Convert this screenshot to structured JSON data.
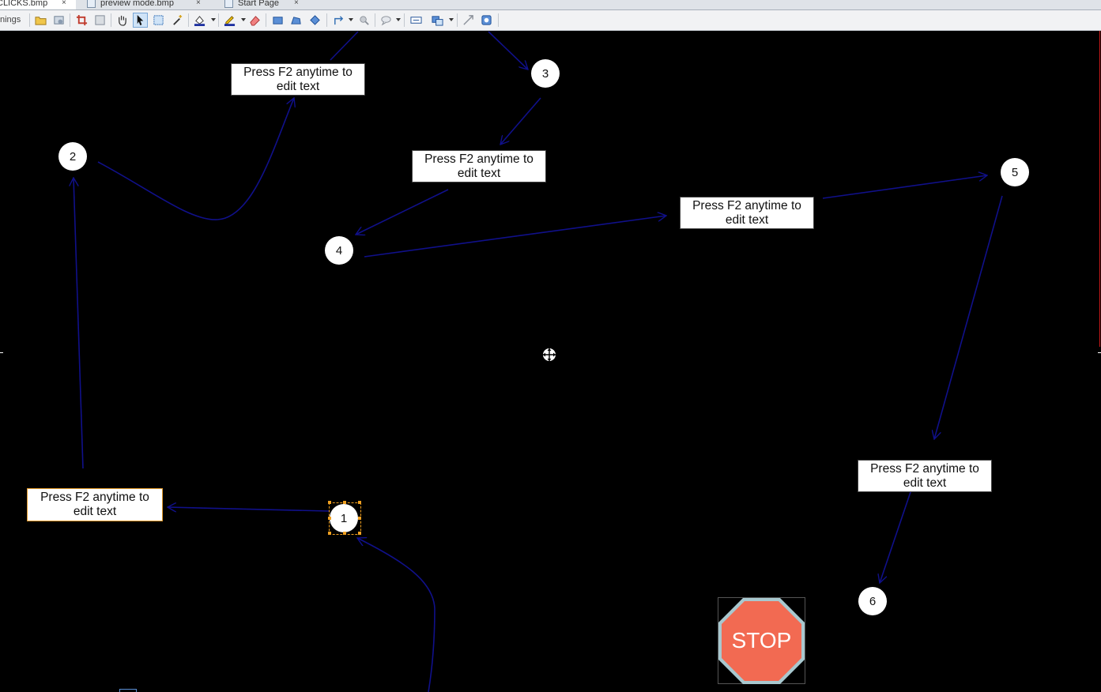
{
  "tabs": [
    {
      "label": "CLICKS.bmp",
      "close": "×"
    },
    {
      "label": "preview mode.bmp",
      "close": "×"
    },
    {
      "label": "Start Page",
      "close": "×"
    }
  ],
  "toolbar": {
    "left_label": "nings",
    "buttons": [
      "open-icon",
      "settings-icon",
      "crop-icon",
      "canvas-size-icon",
      "hand-icon",
      "select-arrow-icon",
      "region-select-icon",
      "magic-wand-icon",
      "fill-color-icon",
      "pen-color-icon",
      "eraser-icon",
      "rectangle-icon",
      "polygon-icon",
      "ellipse-icon",
      "line-arrow-icon",
      "magnify-icon",
      "callout-icon",
      "text-box-icon",
      "step-icon",
      "stamp-icon",
      "cut-out-icon",
      "more-icon"
    ]
  },
  "canvas": {
    "callouts": [
      {
        "id": "a",
        "text": "Press F2 anytime to edit text"
      },
      {
        "id": "b",
        "text": "Press F2 anytime to edit text"
      },
      {
        "id": "c",
        "text": "Press F2 anytime to edit text"
      },
      {
        "id": "d",
        "text": "Press F2 anytime to edit text"
      },
      {
        "id": "e",
        "text": "Press F2 anytime to edit text"
      }
    ],
    "steps": [
      {
        "id": "s1",
        "number": "1",
        "selected": true
      },
      {
        "id": "s2",
        "number": "2"
      },
      {
        "id": "s3",
        "number": "3"
      },
      {
        "id": "s4",
        "number": "4"
      },
      {
        "id": "s5",
        "number": "5"
      },
      {
        "id": "s6",
        "number": "6"
      }
    ],
    "stop_sign": {
      "text": "STOP",
      "fill": "#f26a52",
      "border": "#a8c8cf"
    },
    "arrow_color": "#10108a",
    "selection_color": "#f0a020"
  }
}
